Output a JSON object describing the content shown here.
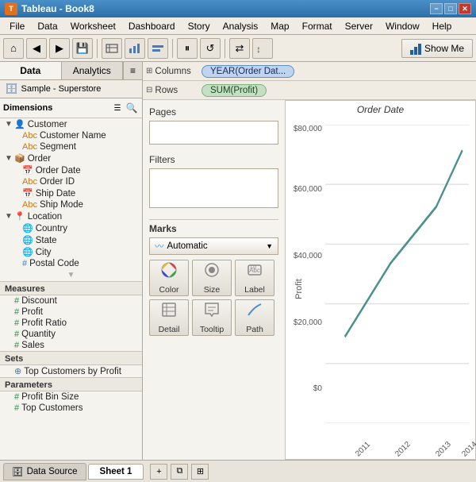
{
  "titleBar": {
    "title": "Tableau - Book8",
    "minLabel": "−",
    "maxLabel": "□",
    "closeLabel": "✕"
  },
  "menuBar": {
    "items": [
      "File",
      "Data",
      "Worksheet",
      "Dashboard",
      "Story",
      "Analysis",
      "Map",
      "Format",
      "Server",
      "Window",
      "Help"
    ]
  },
  "toolbar": {
    "showMeLabel": "Show Me"
  },
  "leftPanel": {
    "tab1": "Data",
    "tab2": "Analytics",
    "datasource": "Sample - Superstore",
    "dimensionsLabel": "Dimensions",
    "dimensions": {
      "customer": {
        "label": "Customer",
        "children": [
          "Customer Name",
          "Segment"
        ]
      },
      "order": {
        "label": "Order",
        "children": [
          "Order Date",
          "Order ID",
          "Ship Date",
          "Ship Mode"
        ]
      },
      "location": {
        "label": "Location",
        "children": [
          "Country",
          "State",
          "City",
          "Postal Code"
        ]
      }
    },
    "measuresLabel": "Measures",
    "measures": [
      "Discount",
      "Profit",
      "Profit Ratio",
      "Quantity",
      "Sales"
    ],
    "setsLabel": "Sets",
    "sets": [
      "Top Customers by Profit"
    ],
    "parametersLabel": "Parameters",
    "parameters": [
      "Profit Bin Size",
      "Top Customers"
    ]
  },
  "shelf": {
    "columnsLabel": "Columns",
    "rowsLabel": "Rows",
    "columnsPill": "YEAR(Order Dat...",
    "rowsPill": "SUM(Profit)"
  },
  "pages": {
    "label": "Pages"
  },
  "filters": {
    "label": "Filters"
  },
  "marks": {
    "label": "Marks",
    "type": "Automatic",
    "buttons": [
      "Color",
      "Size",
      "Label",
      "Detail",
      "Tooltip",
      "Path"
    ]
  },
  "chart": {
    "title": "Order Date",
    "yAxisLabel": "Profit",
    "yLabels": [
      "$80,000",
      "$60,000",
      "$40,000",
      "$20,000",
      "$0"
    ],
    "xLabels": [
      "2011",
      "2012",
      "2013",
      "2014"
    ]
  },
  "bottomTabs": {
    "datasourceTab": "Data Source",
    "sheetTab": "Sheet 1"
  }
}
